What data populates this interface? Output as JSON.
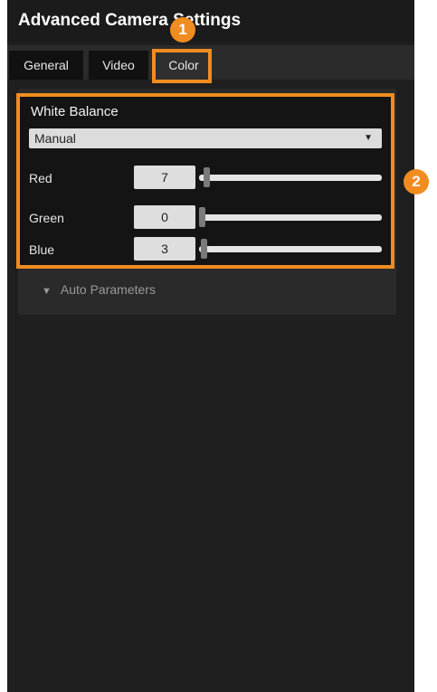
{
  "window": {
    "title": "Advanced Camera Settings"
  },
  "tabs": [
    {
      "label": "General"
    },
    {
      "label": "Video"
    },
    {
      "label": "Color",
      "active": true
    }
  ],
  "white_balance": {
    "title": "White Balance",
    "mode": "Manual",
    "slider_range": [
      0,
      255
    ],
    "sliders": [
      {
        "label": "Red",
        "value": 7
      },
      {
        "label": "Green",
        "value": 0
      },
      {
        "label": "Blue",
        "value": 3
      }
    ]
  },
  "auto_parameters": {
    "label": "Auto Parameters"
  },
  "callouts": [
    "1",
    "2"
  ],
  "colors": {
    "accent": "#f08c20",
    "panel": "#1f1f1f",
    "field": "#dedede"
  },
  "icons": {
    "dropdown": "chevron-down-icon",
    "expander": "chevron-down-icon"
  }
}
